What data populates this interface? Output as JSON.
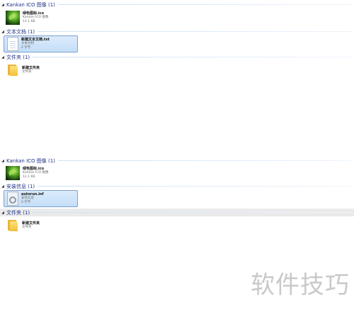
{
  "top_pane": {
    "groups": [
      {
        "header": "Kankan ICO 图像 (1)",
        "items": [
          {
            "name": "绿色图标.ico",
            "type": "Kankan ICO 图像",
            "size": "12.1 KB",
            "thumb": "leaf-icon",
            "selected": false
          }
        ]
      },
      {
        "header": "文本文档 (1)",
        "items": [
          {
            "name": "新建文本文档.txt",
            "type": "文本文档",
            "size": "0 字节",
            "thumb": "text-document-icon",
            "selected": true
          }
        ]
      },
      {
        "header": "文件夹 (1)",
        "items": [
          {
            "name": "新建文件夹",
            "type": "文件夹",
            "size": "",
            "thumb": "folder-icon",
            "selected": false
          }
        ]
      }
    ]
  },
  "bottom_pane": {
    "groups": [
      {
        "header": "Kankan ICO 图像 (1)",
        "items": [
          {
            "name": "绿色图标.ico",
            "type": "Kankan ICO 图像",
            "size": "12.1 KB",
            "thumb": "leaf-icon",
            "selected": false
          }
        ]
      },
      {
        "header": "安装信息 (1)",
        "items": [
          {
            "name": "autorun.inf",
            "type": "安装信息",
            "size": "0 字节",
            "thumb": "settings-file-icon",
            "selected": true
          }
        ]
      },
      {
        "header": "文件夹 (1)",
        "items": [
          {
            "name": "新建文件夹",
            "type": "文件夹",
            "size": "",
            "thumb": "folder-icon",
            "selected": false
          }
        ]
      }
    ]
  },
  "watermark": "软件技巧",
  "colors": {
    "group_header_text": "#1e3287",
    "selection_fill": "#c4def8",
    "selection_border": "#7da2ce"
  }
}
